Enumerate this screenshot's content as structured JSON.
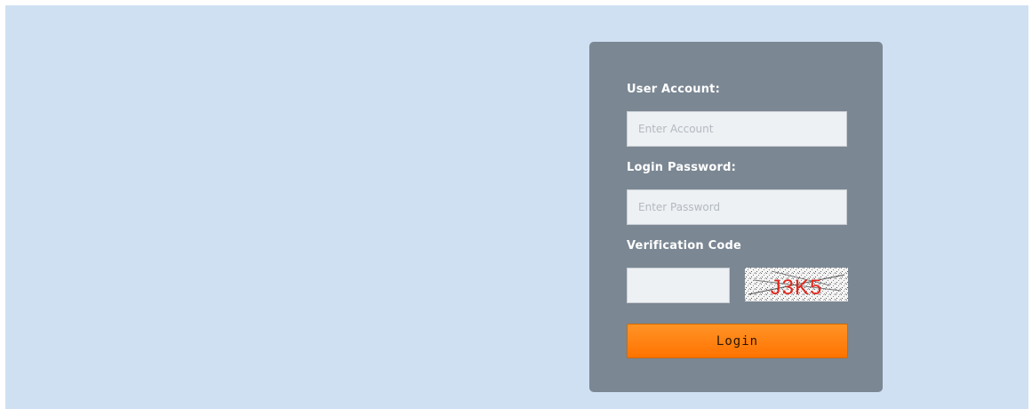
{
  "login_form": {
    "account_label": "User Account:",
    "account_placeholder": "Enter Account",
    "password_label": "Login Password:",
    "password_placeholder": "Enter Password",
    "verification_label": "Verification Code",
    "verification_value": "",
    "captcha_text": "J3K5",
    "login_button": "Login"
  },
  "colors": {
    "page_background": "#cfe0f3",
    "panel_background": "#7b8793",
    "button_orange": "#ff7f0e",
    "captcha_red": "#e0281c"
  }
}
